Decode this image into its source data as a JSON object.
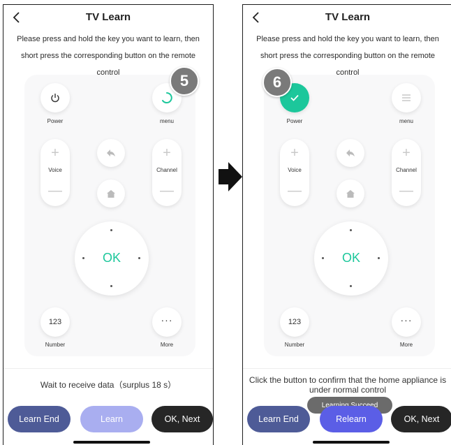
{
  "colors": {
    "accent_green": "#1cc79b",
    "learn_end": "#4e5b97",
    "learn_disabled": "#a9aef0",
    "relearn": "#5b5ee6",
    "ok_next": "#262626"
  },
  "screen1": {
    "title": "TV Learn",
    "instruction": "Please press and hold the key you want to learn, then short press the corresponding button on the remote control",
    "step_badge": "5",
    "labels": {
      "power": "Power",
      "menu": "menu",
      "voice": "Voice",
      "channel": "Channel",
      "ok": "OK",
      "number_btn": "123",
      "number": "Number",
      "more": "More"
    },
    "status": "Wait to receive data（surplus 18 s）",
    "buttons": {
      "learn_end": "Learn End",
      "learn": "Learn",
      "ok_next": "OK, Next"
    }
  },
  "screen2": {
    "title": "TV Learn",
    "instruction": "Please press and hold the key you want to learn, then short press the corresponding button on the remote control",
    "step_badge": "6",
    "labels": {
      "power": "Power",
      "menu": "menu",
      "voice": "Voice",
      "channel": "Channel",
      "ok": "OK",
      "number_btn": "123",
      "number": "Number",
      "more": "More"
    },
    "status": "Click the button to confirm that the home appliance is under normal control",
    "toast": "Learning Succeed",
    "buttons": {
      "learn_end": "Learn End",
      "relearn": "Relearn",
      "ok_next": "OK, Next"
    }
  }
}
